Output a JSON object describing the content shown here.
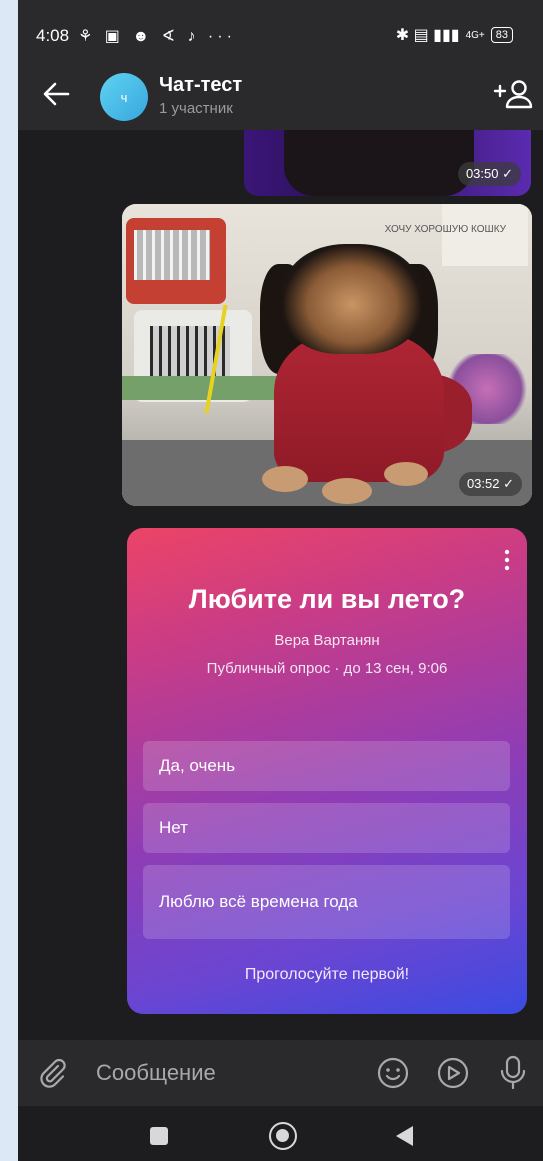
{
  "status_bar": {
    "time": "4:08",
    "left_icons": "⚘ ▣ ☻ ∢ ♪ ···",
    "right_icons": "✱ ▤ ▮▮▮",
    "network": "4G+",
    "battery": "83"
  },
  "header": {
    "avatar_letter": "ч",
    "title": "Чат-тест",
    "subtitle": "1 участник"
  },
  "messages": {
    "photo1_time": "03:50 ✓",
    "photo2_time": "03:52 ✓",
    "photo2_sign": "ХОЧУ ХОРОШУЮ КОШКУ"
  },
  "poll": {
    "question": "Любите ли вы лето?",
    "author": "Вера Вартанян",
    "meta": "Публичный опрос · до 13 сен, 9:06",
    "options": [
      "Да, очень",
      "Нет",
      "Люблю всё времена года"
    ],
    "vote_prompt": "Проголосуйте первой!",
    "gradient_colors": [
      "#ec4466",
      "#8f3db5",
      "#3b4be2"
    ]
  },
  "composer": {
    "placeholder": "Сообщение"
  },
  "icons": [
    "back-arrow-icon",
    "add-user-icon",
    "paperclip-icon",
    "emoji-icon",
    "sticker-icon",
    "microphone-icon",
    "more-icon"
  ]
}
